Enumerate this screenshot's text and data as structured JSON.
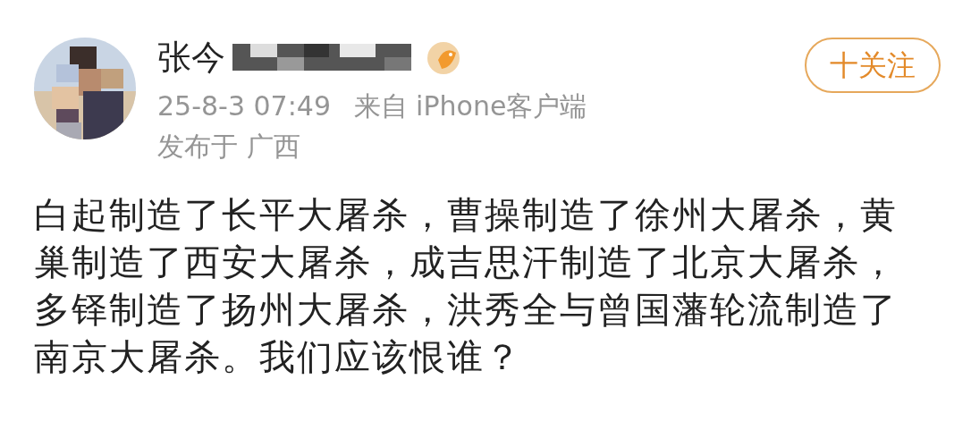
{
  "post": {
    "author": {
      "name": "张今",
      "name_obscured": true,
      "verified": true
    },
    "time": "25-8-3 07:49",
    "source": "来自 iPhone客户端",
    "location": "发布于 广西",
    "follow_button": "十关注",
    "text": "白起制造了长平大屠杀，曹操制造了徐州大屠杀，黄巢制造了西安大屠杀，成吉思汗制造了北京大屠杀，多铎制造了扬州大屠杀，洪秀全与曾国藩轮流制造了南京大屠杀。我们应该恨谁？"
  }
}
